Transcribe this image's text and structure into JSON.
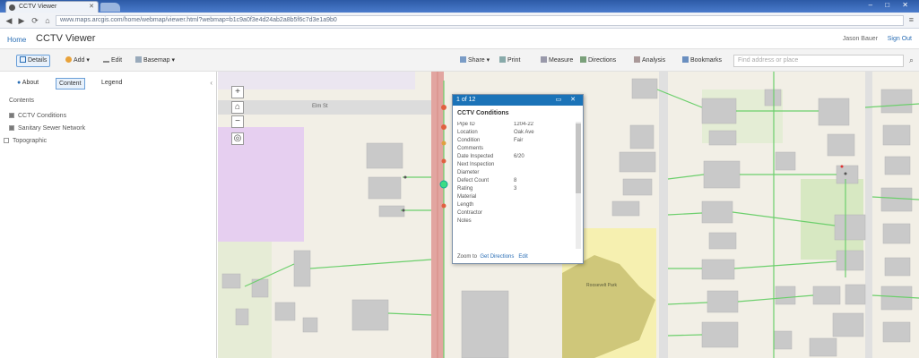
{
  "browser": {
    "tab_title": "CCTV Viewer",
    "url": "www.maps.arcgis.com/home/webmap/viewer.html?webmap=b1c9a0f3e4d24ab2a8b5f6c7d3e1a9b0",
    "window_controls": "– □ ✕"
  },
  "app": {
    "home_label": "Home",
    "title": "CCTV Viewer",
    "user_name": "Jason Bauer",
    "sign_out": "Sign Out"
  },
  "toolbar": {
    "left": [
      {
        "label": "Details",
        "active": true
      },
      {
        "label": "Add",
        "active": false
      },
      {
        "label": "Edit",
        "active": false
      },
      {
        "label": "Basemap",
        "active": false
      }
    ],
    "right": [
      {
        "label": "Share"
      },
      {
        "label": "Print"
      },
      {
        "label": "Measure"
      },
      {
        "label": "Directions"
      },
      {
        "label": "Analysis"
      },
      {
        "label": "Bookmarks"
      }
    ],
    "find_placeholder": "Find address or place"
  },
  "left_panel": {
    "tabs": [
      "About",
      "Content",
      "Legend"
    ],
    "contents_label": "Contents",
    "layers": [
      {
        "label": "CCTV Conditions",
        "checked": true
      },
      {
        "label": "Sanitary Sewer Network",
        "checked": true
      },
      {
        "label": "Topographic",
        "checked": false
      }
    ]
  },
  "popup": {
    "header": "1 of 12",
    "controls": "▭ ✕",
    "title": "CCTV Conditions",
    "rows": [
      {
        "label": "Pipe ID",
        "value": "1204-22"
      },
      {
        "label": "Location",
        "value": "Oak Ave"
      },
      {
        "label": "Condition",
        "value": "Fair"
      },
      {
        "label": "Comments",
        "value": ""
      },
      {
        "label": "Date Inspected",
        "value": "6/20"
      },
      {
        "label": "Next Inspection",
        "value": ""
      },
      {
        "label": "Diameter",
        "value": ""
      },
      {
        "label": "Defect Count",
        "value": "8"
      },
      {
        "label": "Rating",
        "value": "3"
      },
      {
        "label": "Material",
        "value": ""
      },
      {
        "label": "Length",
        "value": ""
      },
      {
        "label": "Contractor",
        "value": ""
      },
      {
        "label": "Notes",
        "value": ""
      }
    ],
    "footer_prefix": "Zoom to",
    "footer_link1": "Get Directions",
    "footer_link2": "Edit"
  },
  "map": {
    "street_label": "Elm St",
    "park_label": "Roosevelt Park"
  },
  "colors": {
    "accent": "#1b73b8",
    "road": "#d8a09a",
    "building": "#c9c9c9",
    "park": "#d9df86",
    "water": "#e6cff0",
    "green": "#d7e8c2",
    "pipe": "#6ccf6c"
  }
}
